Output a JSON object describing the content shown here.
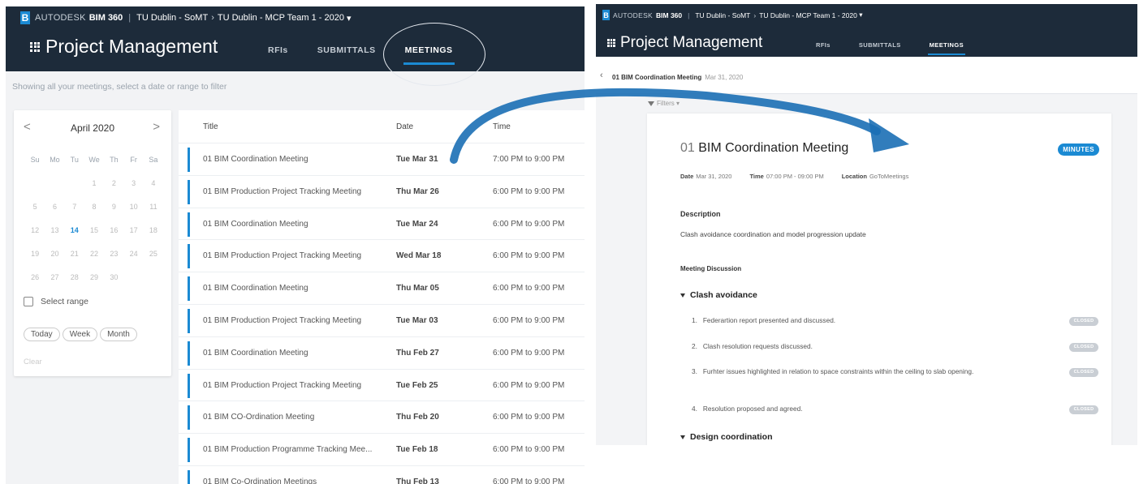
{
  "left": {
    "brand": {
      "company": "AUTODESK",
      "product": "BIM 360",
      "crumb_account": "TU Dublin - SoMT",
      "crumb_project": "TU Dublin - MCP Team 1 - 2020"
    },
    "title": "Project Management",
    "tabs": [
      {
        "label": "RFIs"
      },
      {
        "label": "SUBMITTALS"
      },
      {
        "label": "MEETINGS"
      }
    ],
    "hint": "Showing all your meetings, select a date or range to filter",
    "calendar": {
      "month": "April 2020",
      "prev": "<",
      "next": ">",
      "days_of_week": [
        "Su",
        "Mo",
        "Tu",
        "We",
        "Th",
        "Fr",
        "Sa"
      ],
      "weeks": [
        [
          "",
          "",
          "",
          "1",
          "2",
          "3",
          "4"
        ],
        [
          "5",
          "6",
          "7",
          "8",
          "9",
          "10",
          "11"
        ],
        [
          "12",
          "13",
          "14",
          "15",
          "16",
          "17",
          "18"
        ],
        [
          "19",
          "20",
          "21",
          "22",
          "23",
          "24",
          "25"
        ],
        [
          "26",
          "27",
          "28",
          "29",
          "30",
          "",
          ""
        ]
      ],
      "today": "14",
      "select_range": "Select range",
      "buttons": [
        "Today",
        "Week",
        "Month"
      ],
      "clear": "Clear"
    },
    "table": {
      "headers": {
        "title": "Title",
        "date": "Date",
        "time": "Time"
      },
      "rows": [
        {
          "title": "01 BIM Coordination Meeting",
          "date": "Tue Mar 31",
          "time": "7:00 PM to 9:00 PM"
        },
        {
          "title": "01 BIM Production Project Tracking Meeting",
          "date": "Thu Mar 26",
          "time": "6:00 PM to 9:00 PM"
        },
        {
          "title": "01 BIM Coordination Meeting",
          "date": "Tue Mar 24",
          "time": "6:00 PM to 9:00 PM"
        },
        {
          "title": "01 BIM Production Project Tracking Meeting",
          "date": "Wed Mar 18",
          "time": "6:00 PM to 9:00 PM"
        },
        {
          "title": "01 BIM Coordination Meeting",
          "date": "Thu Mar 05",
          "time": "6:00 PM to 9:00 PM"
        },
        {
          "title": "01 BIM Production Project Tracking Meeting",
          "date": "Tue Mar 03",
          "time": "6:00 PM to 9:00 PM"
        },
        {
          "title": "01 BIM Coordination Meeting",
          "date": "Thu Feb 27",
          "time": "6:00 PM to 9:00 PM"
        },
        {
          "title": "01 BIM Production Project Tracking Meeting",
          "date": "Tue Feb 25",
          "time": "6:00 PM to 9:00 PM"
        },
        {
          "title": "01 BIM CO-Ordination Meeting",
          "date": "Thu Feb 20",
          "time": "6:00 PM to 9:00 PM"
        },
        {
          "title": "01 BIM Production Programme Tracking Mee...",
          "date": "Tue Feb 18",
          "time": "6:00 PM to 9:00 PM"
        },
        {
          "title": "01 BIM Co-Ordination Meetings",
          "date": "Thu Feb 13",
          "time": "6:00 PM to 9:00 PM"
        }
      ]
    }
  },
  "right": {
    "brand": {
      "company": "AUTODESK",
      "product": "BIM 360",
      "crumb_account": "TU Dublin - SoMT",
      "crumb_project": "TU Dublin - MCP Team 1 - 2020"
    },
    "title": "Project Management",
    "tabs": [
      {
        "label": "RFIs"
      },
      {
        "label": "SUBMITTALS"
      },
      {
        "label": "MEETINGS"
      }
    ],
    "breadcrumb": {
      "title": "01 BIM Coordination Meeting",
      "date": "Mar 31, 2020"
    },
    "filters": "Filters",
    "meeting": {
      "number": "01",
      "name": "BIM Coordination Meeting",
      "badge": "MINUTES",
      "date_label": "Date",
      "date": "Mar 31, 2020",
      "time_label": "Time",
      "time": "07:00 PM - 09:00 PM",
      "location_label": "Location",
      "location": "GoToMeetings",
      "description_heading": "Description",
      "description": "Clash avoidance coordination and model progression update",
      "discussion_heading": "Meeting Discussion",
      "sections": [
        {
          "title": "Clash avoidance",
          "items": [
            {
              "num": "1.",
              "text": "Federartion report presented and discussed.",
              "status": "CLOSED"
            },
            {
              "num": "2.",
              "text": "Clash resolution requests discussed.",
              "status": "CLOSED"
            },
            {
              "num": "3.",
              "text": "Furhter issues highlighted in relation to space constraints within the ceiling to slab opening.",
              "status": "CLOSED"
            },
            {
              "num": "4.",
              "text": "Resolution proposed and agreed.",
              "status": "CLOSED"
            }
          ]
        },
        {
          "title": "Design coordination",
          "items": []
        }
      ]
    }
  },
  "colors": {
    "nav_bg": "#1d2b3a",
    "accent": "#1b8ad3",
    "arrow": "#1b6fb5",
    "closed_badge": "#c9ced4"
  }
}
